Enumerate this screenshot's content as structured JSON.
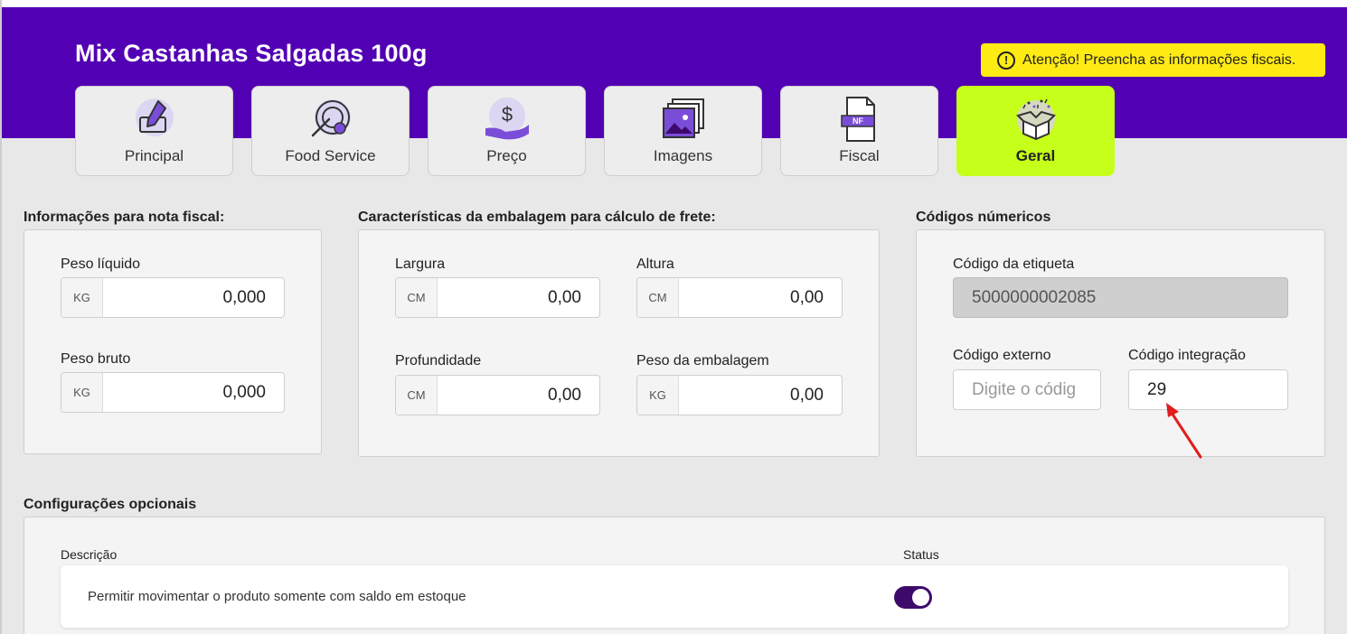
{
  "product": {
    "title": "Mix Castanhas Salgadas 100g"
  },
  "alert": {
    "text": "Atenção! Preencha as informações fiscais.",
    "icon": "warning-circle-icon",
    "color": "#ffeb14"
  },
  "theme": {
    "header_bg": "#5200b3",
    "active_tab_bg": "#c6ff1a",
    "toggle_on": "#3d0a6b",
    "arrow": "#e11d1d"
  },
  "tabs": [
    {
      "label": "Principal",
      "icon": "pencil-box-icon"
    },
    {
      "label": "Food Service",
      "icon": "plate-cutlery-icon"
    },
    {
      "label": "Preço",
      "icon": "hand-dollar-icon"
    },
    {
      "label": "Imagens",
      "icon": "images-stack-icon"
    },
    {
      "label": "Fiscal",
      "icon": "nf-document-icon"
    },
    {
      "label": "Geral",
      "icon": "open-box-icon",
      "active": true
    }
  ],
  "nota_fiscal": {
    "title": "Informações para nota fiscal:",
    "peso_liquido": {
      "label": "Peso líquido",
      "unit": "KG",
      "value": "0,000"
    },
    "peso_bruto": {
      "label": "Peso bruto",
      "unit": "KG",
      "value": "0,000"
    }
  },
  "embalagem": {
    "title": "Características da embalagem para cálculo de frete:",
    "largura": {
      "label": "Largura",
      "unit": "CM",
      "value": "0,00"
    },
    "altura": {
      "label": "Altura",
      "unit": "CM",
      "value": "0,00"
    },
    "profundidade": {
      "label": "Profundidade",
      "unit": "CM",
      "value": "0,00"
    },
    "peso_embalagem": {
      "label": "Peso da embalagem",
      "unit": "KG",
      "value": "0,00"
    }
  },
  "codigos": {
    "title": "Códigos númericos",
    "etiqueta": {
      "label": "Código da etiqueta",
      "value": "5000000002085"
    },
    "externo": {
      "label": "Código externo",
      "placeholder": "Digite o códig"
    },
    "integracao": {
      "label": "Código integração",
      "value": "29"
    }
  },
  "opcionais": {
    "title": "Configurações opcionais",
    "col_descricao": "Descrição",
    "col_status": "Status",
    "rows": [
      {
        "description": "Permitir movimentar o produto somente com saldo em estoque",
        "status": true
      }
    ]
  }
}
